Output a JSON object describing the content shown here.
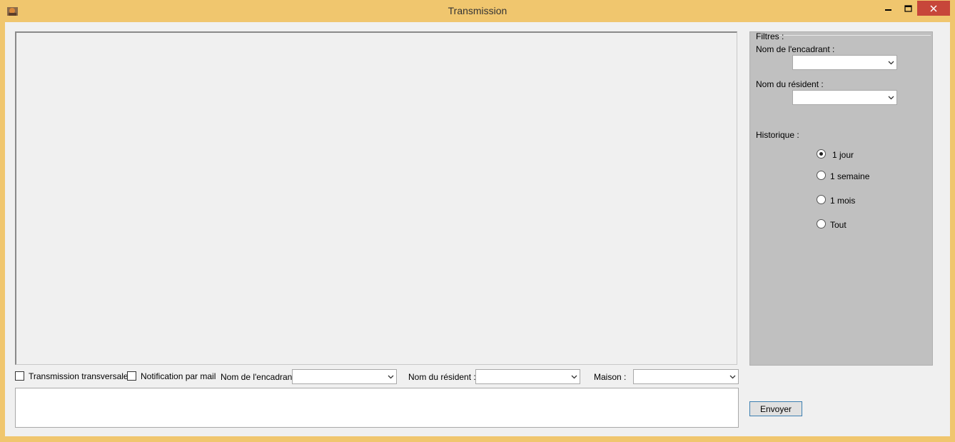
{
  "window": {
    "title": "Transmission",
    "minimize": "–",
    "maximize": "□",
    "close": "✕"
  },
  "filters": {
    "group_label": "Filtres :",
    "encadrant_label": "Nom de l'encadrant :",
    "encadrant_value": "",
    "resident_label": "Nom du résident :",
    "resident_value": "",
    "historique_label": "Historique :",
    "options": [
      "1 jour",
      "1 semaine",
      "1 mois",
      "Tout"
    ],
    "selected": "1 jour"
  },
  "bottom": {
    "transversale_label": "Transmission transversale",
    "notification_label": "Notification par mail",
    "encadrant_label": "Nom de l'encadrant :",
    "encadrant_value": "",
    "resident_label": "Nom du résident :",
    "resident_value": "",
    "maison_label": "Maison :",
    "maison_value": "",
    "message_value": "",
    "send_label": "Envoyer"
  },
  "colors": {
    "titlebar": "#f0c66e",
    "close": "#c7463a",
    "filters_bg": "#c0c0c0"
  }
}
